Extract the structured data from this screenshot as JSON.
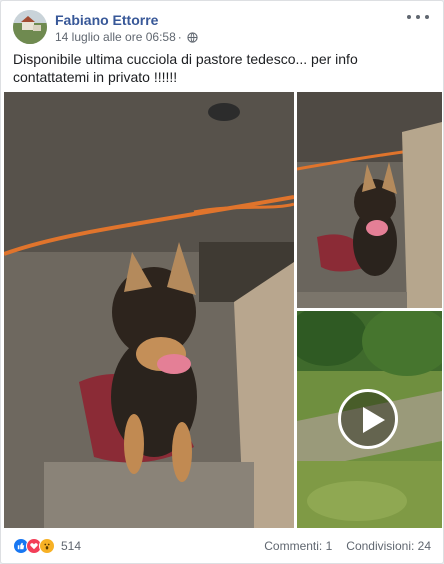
{
  "post": {
    "author": "Fabiano Ettorre",
    "timestamp": "14 luglio alle ore 06:58",
    "privacy_icon": "globe-icon",
    "more_icon": "ellipsis-icon",
    "text": "Disponibile ultima cucciola di pastore tedesco... per info contattatemi in privato !!!!!!"
  },
  "media": {
    "main_photo": "puppy-photo",
    "right_top_photo": "puppy-photo",
    "right_bottom_video": "video-thumbnail",
    "play_icon": "play-icon"
  },
  "footer": {
    "reactions": [
      "like-icon",
      "love-icon",
      "wow-icon"
    ],
    "reaction_count": "514",
    "comments": "Commenti: 1",
    "shares": "Condivisioni: 24"
  },
  "colors": {
    "author": "#385898",
    "like": "#1877f2",
    "love": "#f33e58",
    "wow": "#f7b125"
  }
}
